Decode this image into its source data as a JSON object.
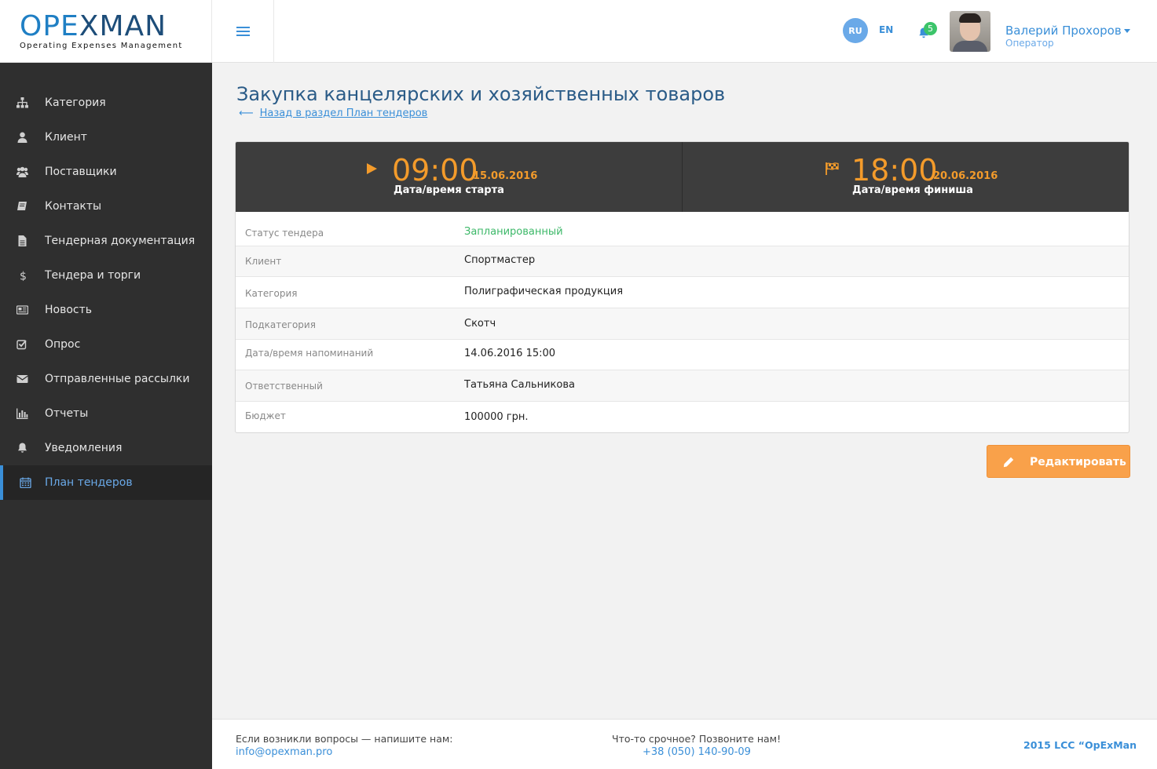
{
  "header": {
    "logo_part1": "OPE",
    "logo_part2": "X",
    "logo_part3": "MAN",
    "logo_subtitle": "Operating Expenses Management",
    "lang_ru": "RU",
    "lang_en": "EN",
    "notifications_count": "5",
    "user_name": "Валерий Прохоров",
    "user_role": "Оператор"
  },
  "sidebar": {
    "items": [
      {
        "label": "Категория",
        "icon": "sitemap-icon"
      },
      {
        "label": "Клиент",
        "icon": "user-icon"
      },
      {
        "label": "Поставщики",
        "icon": "users-icon"
      },
      {
        "label": "Контакты",
        "icon": "book-icon"
      },
      {
        "label": "Тендерная документация",
        "icon": "file-icon"
      },
      {
        "label": "Тендера и торги",
        "icon": "dollar-icon"
      },
      {
        "label": "Новость",
        "icon": "newspaper-icon"
      },
      {
        "label": "Опрос",
        "icon": "check-square-icon"
      },
      {
        "label": "Отправленные рассылки",
        "icon": "envelope-icon"
      },
      {
        "label": "Отчеты",
        "icon": "bar-chart-icon"
      },
      {
        "label": "Уведомления",
        "icon": "bell-icon"
      },
      {
        "label": "План тендеров",
        "icon": "calendar-icon",
        "active": true
      }
    ]
  },
  "main": {
    "title": "Закупка канцелярских и хозяйственных товаров",
    "back_arrow": "⟵",
    "back_link": "Назад в раздел План тендеров",
    "start": {
      "time": "09:00",
      "date": "15.06.2016",
      "caption": "Дата/время старта"
    },
    "finish": {
      "time": "18:00",
      "date": "20.06.2016",
      "caption": "Дата/время финиша"
    },
    "details": [
      {
        "key": "Статус тендера",
        "value": "Запланированный"
      },
      {
        "key": "Клиент",
        "value": "Спортмастер"
      },
      {
        "key": "Категория",
        "value": "Полиграфическая продукция"
      },
      {
        "key": "Подкатегория",
        "value": "Скотч"
      },
      {
        "key": "Дата/время напоминаний",
        "value": "14.06.2016 15:00"
      },
      {
        "key": "Ответственный",
        "value": "Татьяна Сальникова"
      },
      {
        "key": "Бюджет",
        "value": "100000 грн."
      }
    ],
    "edit_button": "Редактировать"
  },
  "footer": {
    "question_text": "Если возникли вопросы — напишите нам:",
    "email": "info@opexman.pro",
    "urgent_text": "Что-то срочное? Позвоните нам!",
    "phone": "+38 (050) 140-90-09",
    "copyright": "2015 LCC “OpExMan"
  },
  "colors": {
    "accent": "#3a8fd8",
    "orange": "#f39b2b",
    "sidebar_bg": "#2f2f2f",
    "status_green": "#3cb868"
  }
}
